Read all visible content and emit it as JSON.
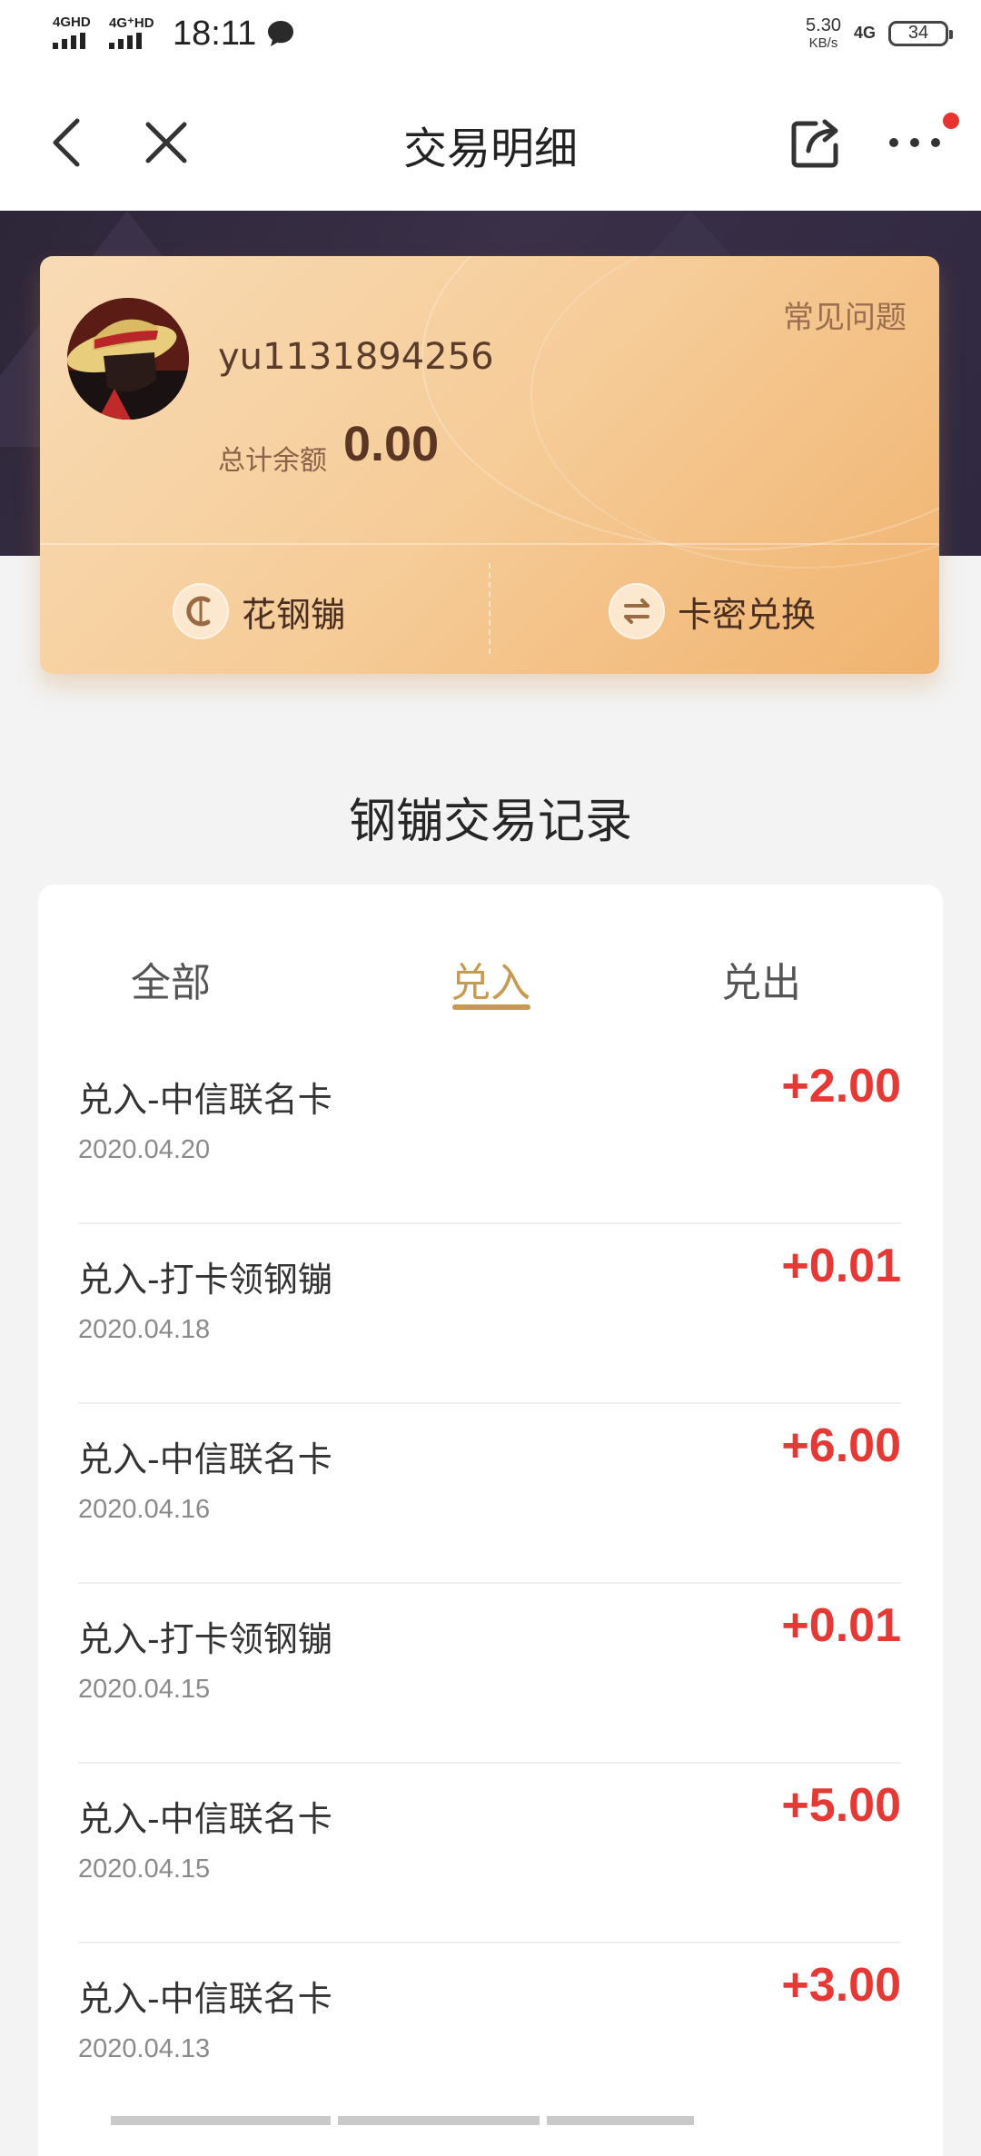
{
  "status_bar": {
    "signal1_label": "4GHD",
    "signal2_label": "4G⁺HD",
    "time": "18:11",
    "net_speed_value": "5.30",
    "net_speed_unit": "KB/s",
    "net_type": "4G",
    "battery": "34"
  },
  "nav": {
    "title": "交易明细"
  },
  "account_card": {
    "username": "yu1131894256",
    "faq_label": "常见问题",
    "balance_label": "总计余额",
    "balance_value": "0.00",
    "action_spend_label": "花钢镚",
    "action_redeem_label": "卡密兑换"
  },
  "records": {
    "section_title": "钢镚交易记录",
    "tabs": [
      {
        "label": "全部",
        "active": false
      },
      {
        "label": "兑入",
        "active": true
      },
      {
        "label": "兑出",
        "active": false
      }
    ],
    "items": [
      {
        "title": "兑入-中信联名卡",
        "date": "2020.04.20",
        "amount": "+2.00"
      },
      {
        "title": "兑入-打卡领钢镚",
        "date": "2020.04.18",
        "amount": "+0.01"
      },
      {
        "title": "兑入-中信联名卡",
        "date": "2020.04.16",
        "amount": "+6.00"
      },
      {
        "title": "兑入-打卡领钢镚",
        "date": "2020.04.15",
        "amount": "+0.01"
      },
      {
        "title": "兑入-中信联名卡",
        "date": "2020.04.15",
        "amount": "+5.00"
      },
      {
        "title": "兑入-中信联名卡",
        "date": "2020.04.13",
        "amount": "+3.00"
      }
    ]
  },
  "icons": {
    "back": "chevron-left-icon",
    "close": "close-icon",
    "share": "share-icon",
    "more": "more-dots-icon",
    "spend": "coin-icon",
    "redeem": "exchange-icon",
    "message": "chat-bubble-icon"
  },
  "colors": {
    "accent_gold": "#c79a4f",
    "amount_red": "#e53935",
    "card_gradient_start": "#f8dbb5",
    "card_gradient_end": "#f0b36f",
    "hero_dark": "#2d2638",
    "badge_red": "#e8332e"
  }
}
